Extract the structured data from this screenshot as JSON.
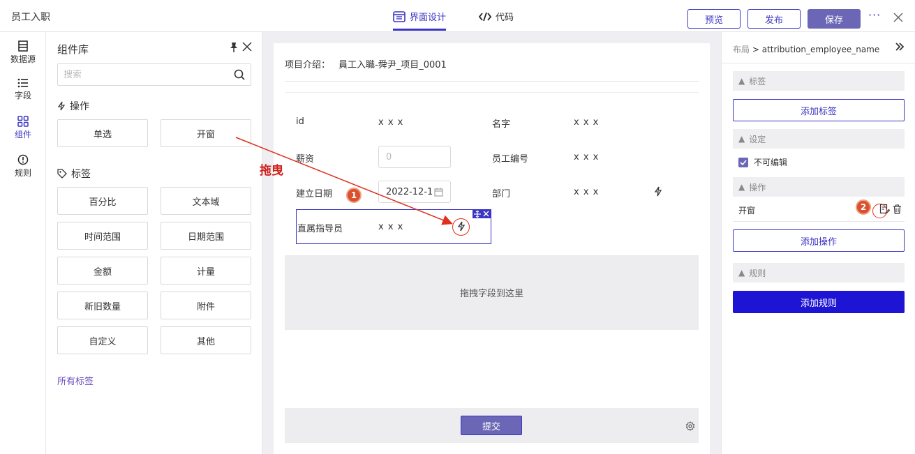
{
  "app": {
    "title": "员工入职"
  },
  "header": {
    "tabs": [
      {
        "label": "界面设计",
        "active": true
      },
      {
        "label": "代码",
        "active": false
      }
    ],
    "preview_label": "预览",
    "publish_label": "发布",
    "save_label": "保存",
    "more_label": "···"
  },
  "left_nav": [
    {
      "label": "数据源",
      "icon": "database-icon"
    },
    {
      "label": "字段",
      "icon": "list-icon"
    },
    {
      "label": "组件",
      "icon": "grid-icon",
      "active": true
    },
    {
      "label": "规则",
      "icon": "info-icon"
    }
  ],
  "component_library": {
    "title": "组件库",
    "search_placeholder": "搜索",
    "operations_title": "操作",
    "operations": [
      "单选",
      "开窗"
    ],
    "tags_title": "标签",
    "tags": [
      "百分比",
      "文本域",
      "时间范围",
      "日期范围",
      "金额",
      "计量",
      "新旧数量",
      "附件",
      "自定义",
      "其他"
    ],
    "all_tags_link": "所有标签"
  },
  "form": {
    "intro_label": "项目介绍：",
    "intro_value": "員工入職-舜尹_项目_0001",
    "fields": {
      "id_label": "id",
      "id_value": "x x x",
      "name_label": "名字",
      "name_value": "x x x",
      "salary_label": "薪资",
      "salary_placeholder": "0",
      "empno_label": "员工编号",
      "empno_value": "x x x",
      "date_label": "建立日期",
      "date_value": "2022-12-1",
      "dept_label": "部门",
      "dept_value": "x x x",
      "supervisor_label": "直属指导员",
      "supervisor_value": "x x x"
    },
    "drop_zone_text": "拖拽字段到这里",
    "submit_label": "提交"
  },
  "right_panel": {
    "breadcrumb_root": "布局",
    "breadcrumb_sep": ">",
    "breadcrumb_current": "attribution_employee_name",
    "sections": {
      "tags": "标签",
      "settings": "设定",
      "actions": "操作",
      "rules": "规则"
    },
    "add_tag_label": "添加标签",
    "readonly_label": "不可编辑",
    "readonly_checked": true,
    "action_item": "开窗",
    "add_action_label": "添加操作",
    "add_rule_label": "添加规则"
  },
  "annotations": {
    "drag_text": "拖曳",
    "step1": "1",
    "step2": "2"
  },
  "colors": {
    "accent": "#3b35c4",
    "primary_button": "#6b66b5",
    "annotation": "#e0301e"
  }
}
